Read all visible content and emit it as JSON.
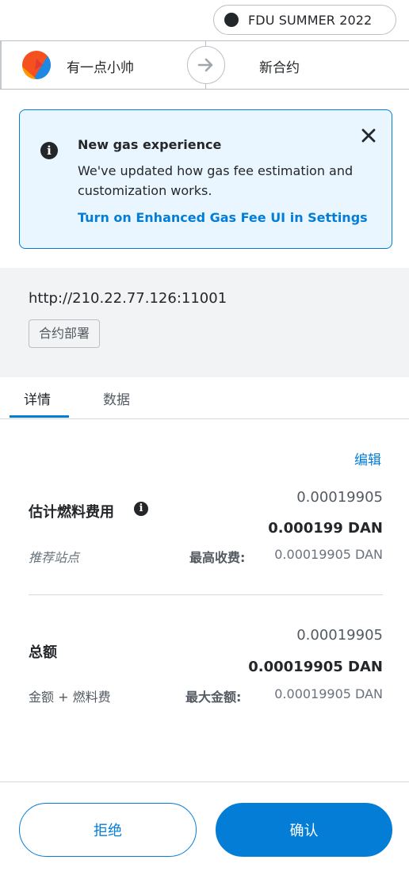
{
  "network": {
    "label": "FDU SUMMER 2022"
  },
  "sender": {
    "name": "有一点小帅"
  },
  "recipient": {
    "name": "新合约"
  },
  "banner": {
    "title": "New gas experience",
    "description": "We've updated how gas fee estimation and customization works.",
    "link_text": "Turn on Enhanced Gas Fee UI in Settings"
  },
  "origin": {
    "url": "http://210.22.77.126:11001",
    "method": "合约部署"
  },
  "tabs": [
    {
      "label": "详情",
      "active": true
    },
    {
      "label": "数据",
      "active": false
    }
  ],
  "details": {
    "edit_label": "编辑",
    "gas": {
      "label": "估计燃料费用",
      "fiat": "0.00019905",
      "primary": "0.000199 DAN",
      "sub_label": "推荐站点",
      "max_label": "最高收费:",
      "max_value": "0.00019905 DAN"
    },
    "total": {
      "label": "总额",
      "fiat": "0.00019905",
      "primary": "0.00019905 DAN",
      "sub_label": "金额 + 燃料费",
      "max_label": "最大金额:",
      "max_value": "0.00019905 DAN"
    }
  },
  "footer": {
    "reject_label": "拒绝",
    "confirm_label": "确认"
  },
  "colors": {
    "primary": "#037dd6",
    "banner_bg": "#eaf6ff",
    "origin_bg": "#f2f3f4",
    "text": "#24272a"
  },
  "icons": {
    "network": "network-dot-icon",
    "avatar": "jazzicon-avatar",
    "arrow": "arrow-right-icon",
    "banner_info": "info-icon",
    "banner_close": "close-icon",
    "gas_info": "info-icon"
  }
}
